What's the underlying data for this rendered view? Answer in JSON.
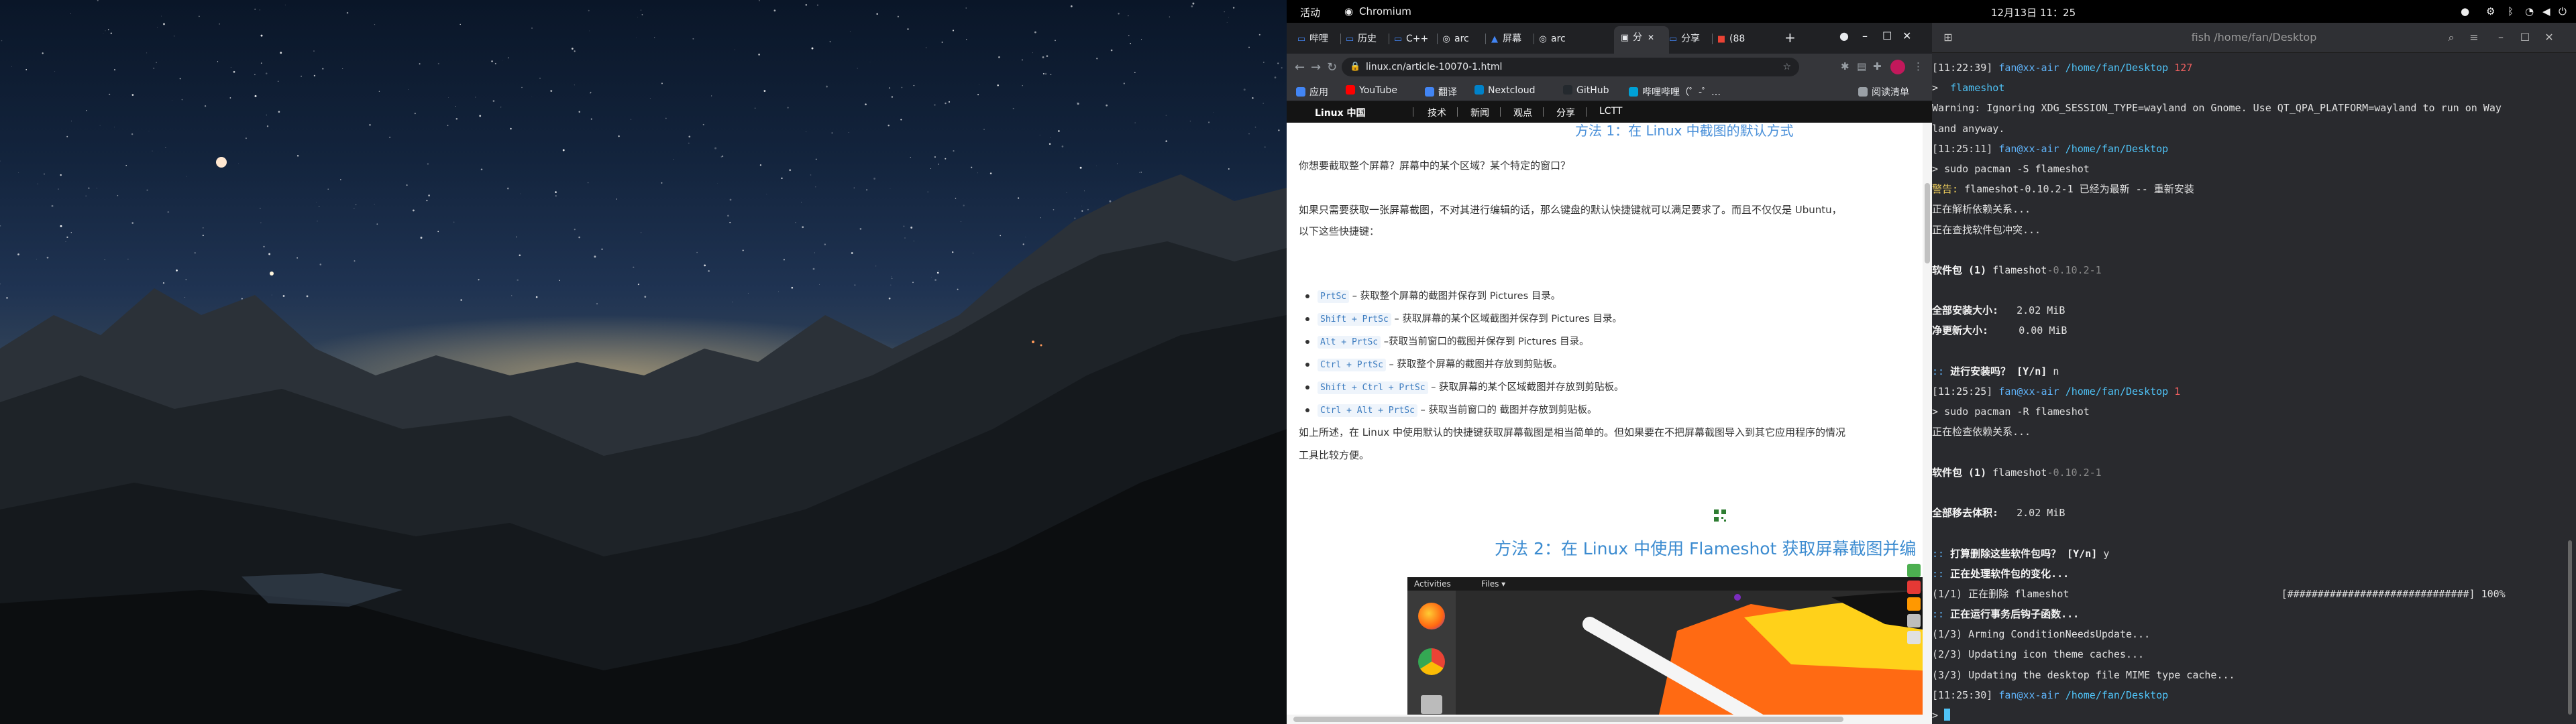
{
  "topbar": {
    "activities": "活动",
    "app_name": "Chromium",
    "clock": "12月13日 11：25"
  },
  "chromium": {
    "tabs": [
      {
        "label": "哔哩"
      },
      {
        "label": "历史"
      },
      {
        "label": "C++"
      },
      {
        "label": "arc"
      },
      {
        "label": "屏幕"
      },
      {
        "label": "arc"
      },
      {
        "label": "分"
      },
      {
        "label": "分享"
      },
      {
        "label": "(88"
      }
    ],
    "new_tab": "+",
    "url": "linux.cn/article-10070-1.html",
    "bookmarks": [
      {
        "label": "应用",
        "color": "#4285f4"
      },
      {
        "label": "YouTube",
        "color": "#ff0000"
      },
      {
        "label": "翻译",
        "color": "#4285f4"
      },
      {
        "label": "Nextcloud",
        "color": "#0082c9"
      },
      {
        "label": "GitHub",
        "color": "#24292e"
      },
      {
        "label": "哔哩哔哩（゜-゜…",
        "color": "#00a1d6"
      },
      {
        "label": "阅读清单",
        "color": "#9aa0a6"
      }
    ],
    "site": {
      "logo": "Linux 中国",
      "nav": [
        "技术",
        "新闻",
        "观点",
        "分享",
        "LCTT"
      ],
      "heading_peek": "方法 1：在 Linux 中截图的默认方式",
      "intro": "你想要截取整个屏幕？屏幕中的某个区域？某个特定的窗口？",
      "para2_line1": "如果只需要获取一张屏幕截图，不对其进行编辑的话，那么键盘的默认快捷键就可以满足要求了。而且不仅仅是 Ubuntu，",
      "para2_line2": "以下这些快捷键：",
      "shortcuts": [
        {
          "key": "PrtSc",
          "desc": "– 获取整个屏幕的截图并保存到 Pictures 目录。"
        },
        {
          "key": "Shift + PrtSc",
          "desc": "– 获取屏幕的某个区域截图并保存到 Pictures 目录。"
        },
        {
          "key": "Alt + PrtSc",
          "desc": "–获取当前窗口的截图并保存到 Pictures 目录。"
        },
        {
          "key": "Ctrl + PrtSc",
          "desc": "– 获取整个屏幕的截图并存放到剪贴板。"
        },
        {
          "key": "Shift + Ctrl + PrtSc",
          "desc": "– 获取屏幕的某个区域截图并存放到剪贴板。"
        },
        {
          "key": "Ctrl + Alt + PrtSc",
          "desc": "– 获取当前窗口的 截图并存放到剪贴板。"
        }
      ],
      "para3_line1": "如上所述，在 Linux 中使用默认的快捷键获取屏幕截图是相当简单的。但如果要在不把屏幕截图导入到其它应用程序的情况",
      "para3_line2": "工具比较方便。",
      "method2": "方法 2：在 Linux 中使用 Flameshot 获取屏幕截图并编",
      "screenshot_bar": {
        "activities": "Activities",
        "files": "Files ▾"
      }
    }
  },
  "terminal": {
    "title": "fish /home/fan/Desktop",
    "lines": [
      [
        {
          "t": "[11:22:39] ",
          "c": "c-white"
        },
        {
          "t": "fan@xx-air ",
          "c": "c-blue"
        },
        {
          "t": "/home/fan/Desktop ",
          "c": "c-cyan"
        },
        {
          "t": "127",
          "c": "c-red"
        }
      ],
      [
        {
          "t": "> ",
          "c": "c-white"
        },
        {
          "t": " flameshot",
          "c": "c-cyan"
        }
      ],
      [
        {
          "t": "Warning: Ignoring XDG_SESSION_TYPE=wayland on Gnome. Use QT_QPA_PLATFORM=wayland to run on Way",
          "c": "c-white"
        }
      ],
      [
        {
          "t": "land anyway.",
          "c": "c-white"
        }
      ],
      [
        {
          "t": "[11:25:11] ",
          "c": "c-white"
        },
        {
          "t": "fan@xx-air ",
          "c": "c-blue"
        },
        {
          "t": "/home/fan/Desktop",
          "c": "c-cyan"
        }
      ],
      [
        {
          "t": "> ",
          "c": "c-white"
        },
        {
          "t": "sudo pacman -S flameshot",
          "c": "c-white"
        }
      ],
      [
        {
          "t": "警告: ",
          "c": "c-yellow"
        },
        {
          "t": "flameshot-0.10.2-1 已经为最新 -- 重新安装",
          "c": "c-white"
        }
      ],
      [
        {
          "t": "正在解析依赖关系...",
          "c": "c-white"
        }
      ],
      [
        {
          "t": "正在查找软件包冲突...",
          "c": "c-white"
        }
      ],
      [
        {
          "t": "",
          "c": "c-white"
        }
      ],
      [
        {
          "t": "软件包 (1) ",
          "c": "c-bold"
        },
        {
          "t": "flameshot",
          "c": "c-white"
        },
        {
          "t": "-0.10.2-1",
          "c": "c-gray"
        }
      ],
      [
        {
          "t": "",
          "c": "c-white"
        }
      ],
      [
        {
          "t": "全部安装大小:   ",
          "c": "c-bold"
        },
        {
          "t": "2.02 MiB",
          "c": "c-white"
        }
      ],
      [
        {
          "t": "净更新大小:     ",
          "c": "c-bold"
        },
        {
          "t": "0.00 MiB",
          "c": "c-white"
        }
      ],
      [
        {
          "t": "",
          "c": "c-white"
        }
      ],
      [
        {
          "t": ":: ",
          "c": "c-blue"
        },
        {
          "t": "进行安装吗？ [Y/n] ",
          "c": "c-bold"
        },
        {
          "t": "n",
          "c": "c-white"
        }
      ],
      [
        {
          "t": "[11:25:25] ",
          "c": "c-white"
        },
        {
          "t": "fan@xx-air ",
          "c": "c-blue"
        },
        {
          "t": "/home/fan/Desktop ",
          "c": "c-cyan"
        },
        {
          "t": "1",
          "c": "c-red"
        }
      ],
      [
        {
          "t": "> ",
          "c": "c-white"
        },
        {
          "t": "sudo pacman -R flameshot",
          "c": "c-white"
        }
      ],
      [
        {
          "t": "正在检查依赖关系...",
          "c": "c-white"
        }
      ],
      [
        {
          "t": "",
          "c": "c-white"
        }
      ],
      [
        {
          "t": "软件包 (1) ",
          "c": "c-bold"
        },
        {
          "t": "flameshot",
          "c": "c-white"
        },
        {
          "t": "-0.10.2-1",
          "c": "c-gray"
        }
      ],
      [
        {
          "t": "",
          "c": "c-white"
        }
      ],
      [
        {
          "t": "全部移去体积:   ",
          "c": "c-bold"
        },
        {
          "t": "2.02 MiB",
          "c": "c-white"
        }
      ],
      [
        {
          "t": "",
          "c": "c-white"
        }
      ],
      [
        {
          "t": ":: ",
          "c": "c-blue"
        },
        {
          "t": "打算删除这些软件包吗？ [Y/n] ",
          "c": "c-bold"
        },
        {
          "t": "y",
          "c": "c-white"
        }
      ],
      [
        {
          "t": ":: ",
          "c": "c-blue"
        },
        {
          "t": "正在处理软件包的变化...",
          "c": "c-bold"
        }
      ],
      [
        {
          "t": "(1/1) 正在删除 flameshot                                   [##############################] 100%",
          "c": "c-white"
        }
      ],
      [
        {
          "t": ":: ",
          "c": "c-blue"
        },
        {
          "t": "正在运行事务后钩子函数...",
          "c": "c-bold"
        }
      ],
      [
        {
          "t": "(1/3) Arming ConditionNeedsUpdate...",
          "c": "c-white"
        }
      ],
      [
        {
          "t": "(2/3) Updating icon theme caches...",
          "c": "c-white"
        }
      ],
      [
        {
          "t": "(3/3) Updating the desktop file MIME type cache...",
          "c": "c-white"
        }
      ],
      [
        {
          "t": "[11:25:30] ",
          "c": "c-white"
        },
        {
          "t": "fan@xx-air ",
          "c": "c-blue"
        },
        {
          "t": "/home/fan/Desktop",
          "c": "c-cyan"
        }
      ],
      [
        {
          "t": "> ",
          "c": "c-white"
        }
      ]
    ]
  }
}
